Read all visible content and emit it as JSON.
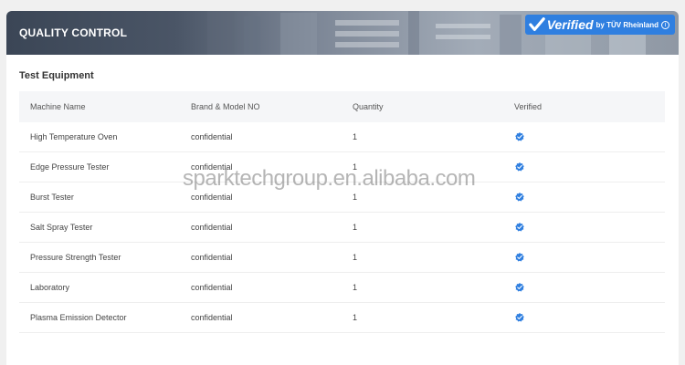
{
  "header": {
    "title": "QUALITY CONTROL",
    "badge": {
      "verified_word": "Verified",
      "by_text": "by TÜV Rheinland",
      "info_glyph": "i",
      "icon": "check-icon",
      "color": "#2f7fe0"
    }
  },
  "section": {
    "title": "Test Equipment"
  },
  "table": {
    "columns": [
      "Machine Name",
      "Brand & Model NO",
      "Quantity",
      "Verified"
    ],
    "rows": [
      {
        "name": "High Temperature Oven",
        "brand": "confidential",
        "quantity": "1",
        "verified": true
      },
      {
        "name": "Edge Pressure Tester",
        "brand": "confidential",
        "quantity": "1",
        "verified": true
      },
      {
        "name": "Burst Tester",
        "brand": "confidential",
        "quantity": "1",
        "verified": true
      },
      {
        "name": "Salt Spray Tester",
        "brand": "confidential",
        "quantity": "1",
        "verified": true
      },
      {
        "name": "Pressure Strength Tester",
        "brand": "confidential",
        "quantity": "1",
        "verified": true
      },
      {
        "name": "Laboratory",
        "brand": "confidential",
        "quantity": "1",
        "verified": true
      },
      {
        "name": "Plasma Emission Detector",
        "brand": "confidential",
        "quantity": "1",
        "verified": true
      }
    ],
    "verified_icon": "verified-check-icon",
    "verified_color": "#2f7fe0"
  },
  "watermark": "sparktechgroup.en.alibaba.com"
}
